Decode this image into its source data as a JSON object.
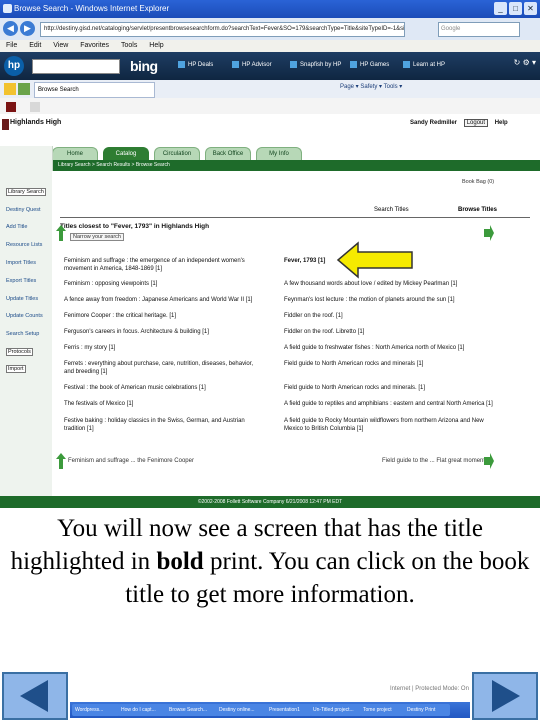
{
  "browser": {
    "title": "Browse Search - Windows Internet Explorer",
    "address": "http://destiny.gisd.net/cataloging/servlet/presentbrowsesearchform.do?searchText=Fever&SO=179&searchType=Title&siteTypeID=-1&siteID=&includeLibrary=",
    "search_placeholder": "Google",
    "menu": [
      "File",
      "Edit",
      "View",
      "Favorites",
      "Tools",
      "Help"
    ],
    "bing_label": "bing",
    "bing_items": [
      "HP Deals",
      "HP Advisor",
      "Snapfish by HP",
      "HP Games",
      "Learn at HP"
    ],
    "tab_label": "Browse Search",
    "toolbar_items": "Page ▾  Safety ▾  Tools ▾"
  },
  "page": {
    "school": "Highlands High",
    "user": "Sandy Redmiller",
    "logout": "Logout",
    "help": "Help",
    "tabs": [
      "Home",
      "Catalog",
      "Circulation",
      "Back Office",
      "My Info"
    ],
    "breadcrumb": "Library Search > Search Results > Browse Search",
    "sidebar": [
      "Library Search",
      "Destiny Quest",
      "Add Title",
      "Resource Lists",
      "Import Titles",
      "Export Titles",
      "Update Titles",
      "Update Counts",
      "Search Setup",
      "Protocols",
      "Import"
    ],
    "book_bag": "Book Bag (0)",
    "view_tabs": [
      "Search Titles",
      "Browse Titles"
    ],
    "heading": "Titles closest to \"Fever, 1793\" in Highlands High",
    "narrow": "Narrow your search",
    "left_titles": [
      "Feminism and suffrage : the emergence of an independent women's movement in America, 1848-1869  [1]",
      "Feminism : opposing viewpoints  [1]",
      "A fence away from freedom : Japanese Americans and World War II  [1]",
      "Fenimore Cooper : the critical heritage.  [1]",
      "Ferguson's careers in focus. Architecture & building  [1]",
      "Ferris : my story  [1]",
      "Ferrets : everything about purchase, care, nutrition, diseases, behavior, and breeding  [1]",
      "Festival : the book of American music celebrations  [1]",
      "The festivals of Mexico  [1]",
      "Festive baking : holiday classics in the Swiss, German, and Austrian tradition  [1]"
    ],
    "right_titles": [
      "Fever, 1793  [1]",
      "A few thousand words about love / edited by Mickey Pearlman  [1]",
      "Feynman's lost lecture : the motion of planets around the sun  [1]",
      "Fiddler on the roof.  [1]",
      "Fiddler on the roof. Libretto  [1]",
      "A field guide to freshwater fishes : North America north of Mexico  [1]",
      "Field guide to North American rocks and minerals  [1]",
      "Field guide to North American rocks and minerals.  [1]",
      "A field guide to reptiles and amphibians : eastern and central North America  [1]",
      "A field guide to Rocky Mountain wildflowers from northern Arizona and New Mexico to British Columbia  [1]"
    ],
    "prev_link": "Feminism and suffrage ... the Fenimore Cooper",
    "next_link": "Field guide to the ... Flat great moment",
    "footer": "©2002-2008 Follett Software Company    6/21/2008 12:47 PM EDT"
  },
  "caption": {
    "part1": "You will now see a screen that has the title highlighted in ",
    "bold": "bold",
    "part2": " print.  You can click on the book title to get more information."
  },
  "taskbar": {
    "items": [
      "Wordpress...",
      "How do I capt...",
      "Browse Search...",
      "Destiny online...",
      "Presentation1",
      "Un-Titled project...",
      "Tome project",
      "Destiny Print"
    ],
    "tray": "Internet | Protected Mode: On"
  },
  "colors": {
    "destiny_green": "#1e6b2a",
    "arrow_yellow": "#f5ea00",
    "nav_blue": "#8fb6e8"
  }
}
